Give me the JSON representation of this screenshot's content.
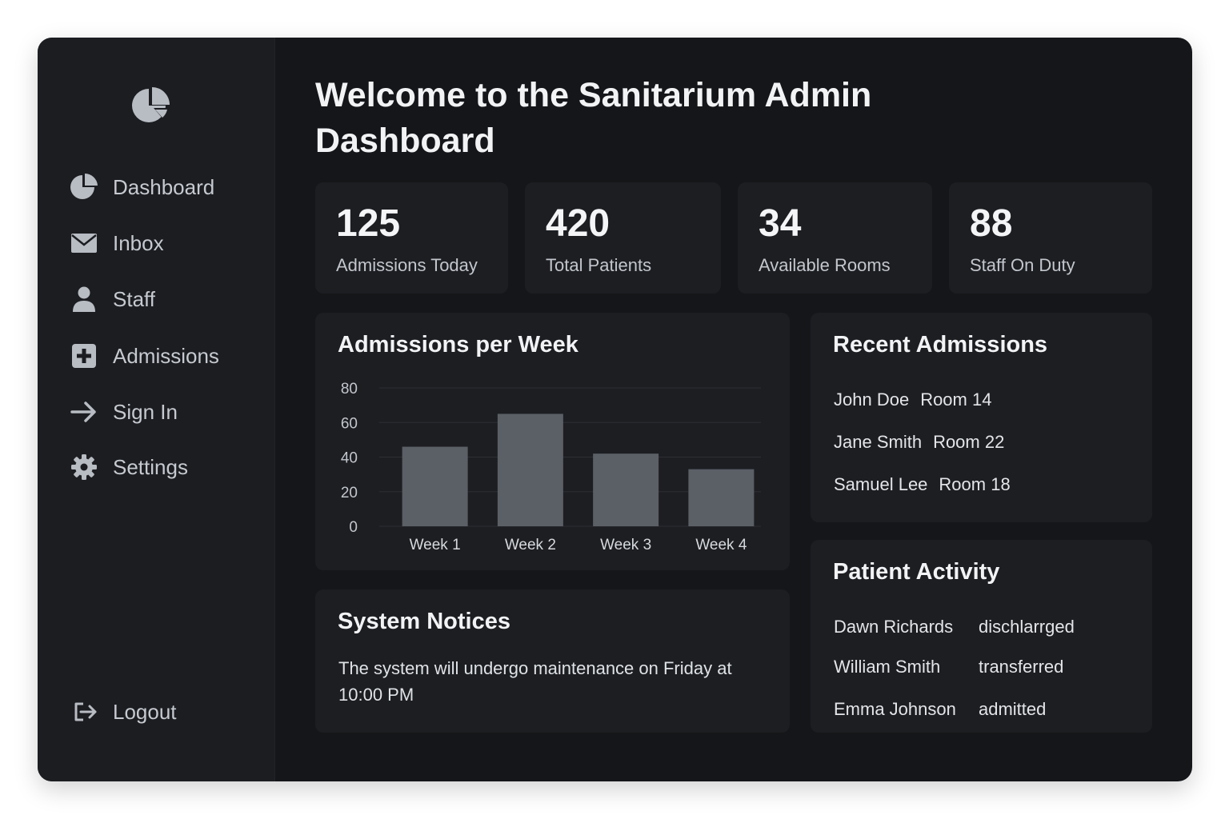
{
  "sidebar": {
    "logo_icon": "pie-chart-icon",
    "items": [
      {
        "label": "Dashboard",
        "icon": "pie-chart-icon"
      },
      {
        "label": "Inbox",
        "icon": "mail-icon"
      },
      {
        "label": "Staff",
        "icon": "user-icon"
      },
      {
        "label": "Admissions",
        "icon": "plus-square-icon"
      },
      {
        "label": "Sign In",
        "icon": "arrow-right-icon"
      },
      {
        "label": "Settings",
        "icon": "gear-icon"
      }
    ],
    "logout": {
      "label": "Logout",
      "icon": "logout-icon"
    }
  },
  "header": {
    "title": "Welcome to the Sanitarium Admin Dashboard"
  },
  "stats": [
    {
      "value": "125",
      "label": "Admissions Today"
    },
    {
      "value": "420",
      "label": "Total Patients"
    },
    {
      "value": "34",
      "label": "Available Rooms"
    },
    {
      "value": "88",
      "label": "Staff On Duty"
    }
  ],
  "chart_panel": {
    "title": "Admissions per Week"
  },
  "chart_data": {
    "type": "bar",
    "title": "Admissions per Week",
    "categories": [
      "Week 1",
      "Week 2",
      "Week 3",
      "Week 4"
    ],
    "values": [
      46,
      65,
      42,
      33
    ],
    "yticks": [
      "0",
      "20",
      "40",
      "60",
      "80"
    ],
    "ylim": [
      0,
      80
    ],
    "grid": true,
    "bar_color": "#5b5f66",
    "grid_color": "#2c2f34"
  },
  "recent": {
    "title": "Recent Admissions",
    "rows": [
      {
        "name": "John Doe",
        "room": "Room 14"
      },
      {
        "name": "Jane Smith",
        "room": "Room 22"
      },
      {
        "name": "Samuel Lee",
        "room": "Room 18"
      }
    ]
  },
  "activity": {
    "title": "Patient Activity",
    "rows": [
      {
        "name": "Dawn Richards",
        "status": "dischlarrged"
      },
      {
        "name": "William Smith",
        "status": "transferred"
      },
      {
        "name": "Emma Johnson",
        "status": "admitted"
      }
    ]
  },
  "notices": {
    "title": "System Notices",
    "text": "The system will undergo maintenance on Friday at 10:00 PM"
  },
  "colors": {
    "window_bg": "#141619",
    "sidebar_bg": "#1b1d21",
    "card_bg": "#1c1e22",
    "icon_color": "#b8bcc3"
  }
}
